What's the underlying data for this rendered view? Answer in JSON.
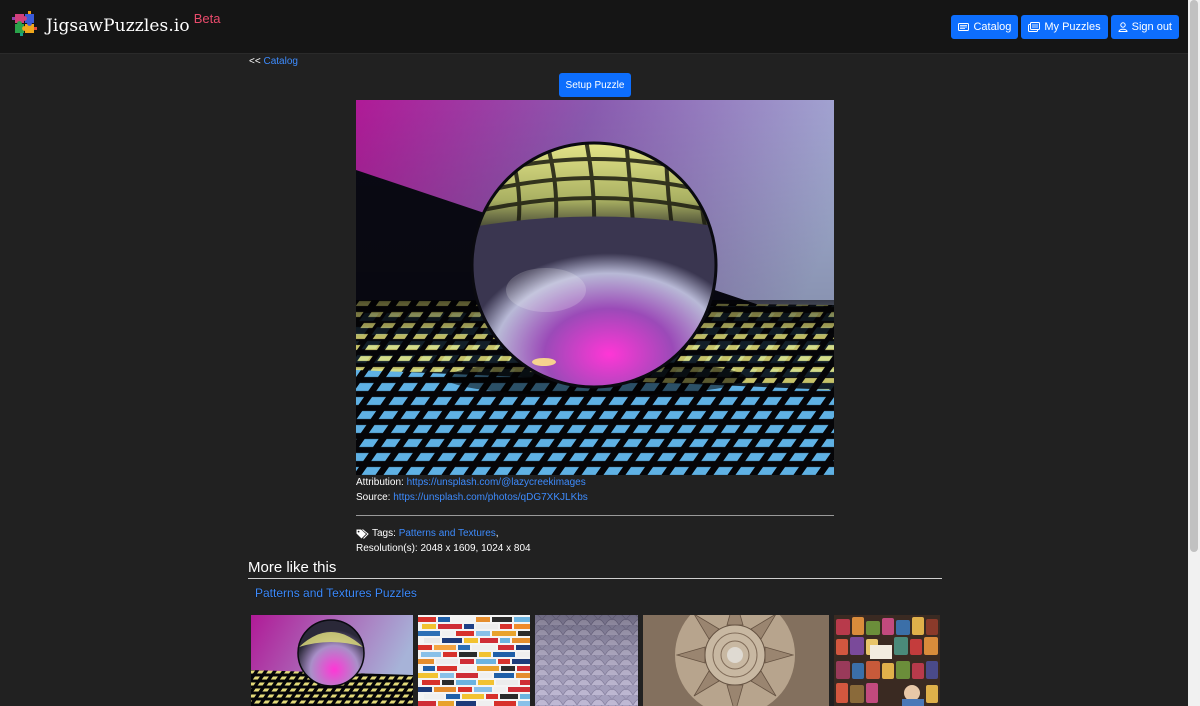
{
  "navbar": {
    "brand": "JigsawPuzzles.io",
    "beta": "Beta",
    "buttons": {
      "catalog": "Catalog",
      "my_puzzles": "My Puzzles",
      "sign_out": "Sign out"
    }
  },
  "breadcrumb": {
    "prefix": "<<",
    "link": "Catalog"
  },
  "setup_button": "Setup Puzzle",
  "details": {
    "attribution_label": "Attribution:",
    "attribution_url": "https://unsplash.com/@lazycreekimages",
    "source_label": "Source:",
    "source_url": "https://unsplash.com/photos/qDG7XKJLKbs",
    "tags_label": "Tags:",
    "tag": "Patterns and Textures",
    "tag_separator": ",",
    "resolutions_label": "Resolution(s):",
    "resolutions": "2048 x 1609, 1024 x 804"
  },
  "more": {
    "title": "More like this",
    "category_link": "Patterns and Textures Puzzles"
  },
  "colors": {
    "accent": "#0d6efd",
    "link": "#3d8bfd",
    "beta": "#e94b6c",
    "background": "#212121",
    "navbar": "#151515"
  }
}
